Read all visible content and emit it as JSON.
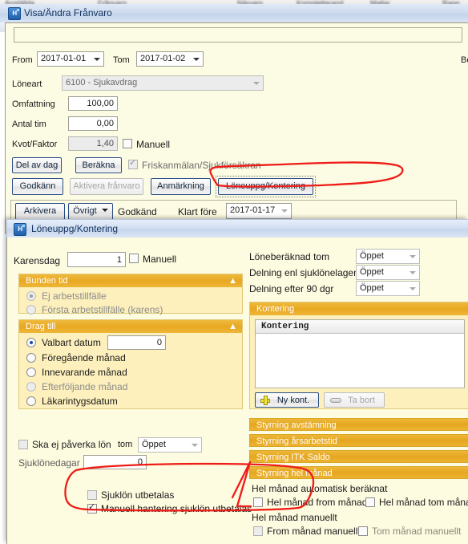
{
  "desktop": {
    "blurred_tabs": [
      "Anställda",
      "Frånvaro",
      "Närvaro",
      "Kompletterand",
      "Mallar",
      "Rapp"
    ]
  },
  "window1": {
    "title": "Visa/Ändra Frånvaro",
    "icon": "hogia-app-icon",
    "fields": {
      "from_label": "From",
      "from_value": "2017-01-01",
      "tom_label": "Tom",
      "tom_value": "2017-01-02",
      "loneart_label": "Löneart",
      "loneart_value": "6100 - Sjukavdrag",
      "omfattning_label": "Omfattning",
      "omfattning_value": "100,00",
      "antal_tim_label": "Antal tim",
      "antal_tim_value": "0,00",
      "kvot_faktor_label": "Kvot/Faktor",
      "kvot_faktor_value": "1,40",
      "manuell_label": "Manuell",
      "manuell_checked": false,
      "cut_off_right_label": "Be"
    },
    "buttons": {
      "del_av_dag": "Del av dag",
      "berakna": "Beräkna",
      "godkann": "Godkänn",
      "aktivera_franvaro": "Aktivera frånvaro",
      "anmarkning": "Anmärkning",
      "loneuppg_kontering": "Löneuppg/Kontering",
      "arkivera": "Arkivera",
      "ovrigt": "Övrigt"
    },
    "friskanmalan_label": "Friskanmälan/Sjukförsäkran",
    "friskanmalan_checked": true,
    "status_label": "Godkänd",
    "klart_fore_label": "Klart före",
    "klart_fore_value": "2017-01-17"
  },
  "window2": {
    "title": "Löneuppg/Kontering",
    "icon": "hogia-app-icon",
    "karensdag_label": "Karensdag",
    "karensdag_value": "1",
    "karensdag_manuell_label": "Manuell",
    "karensdag_manuell_checked": false,
    "bunden_tid": {
      "header": "Bunden tid",
      "options": [
        {
          "label": "Ej arbetstillfälle",
          "selected": true,
          "disabled": true
        },
        {
          "label": "Första arbetstillfälle (karens)",
          "selected": false,
          "disabled": true
        }
      ]
    },
    "drag_till": {
      "header": "Drag till",
      "options": [
        {
          "label": "Valbart datum",
          "selected": true,
          "disabled": false
        },
        {
          "label": "Föregående månad",
          "selected": false,
          "disabled": false
        },
        {
          "label": "Innevarande månad",
          "selected": false,
          "disabled": false
        },
        {
          "label": "Efterföljande månad",
          "selected": false,
          "disabled": true
        },
        {
          "label": "Läkarintygsdatum",
          "selected": false,
          "disabled": false
        }
      ],
      "valbart_datum_value": "0"
    },
    "ska_ej_paverka_lon_label": "Ska ej påverka lön",
    "ska_ej_paverka_lon_checked": false,
    "tom_label": "tom",
    "tom_value": "Öppet",
    "sjuklonedagar_label": "Sjuklönedagar",
    "sjuklonedagar_value": "0",
    "sjuklon_utbetalas_label": "Sjuklön utbetalas",
    "sjuklon_utbetalas_checked": false,
    "manuell_hantering_label": "Manuell hantering sjuklön utbetalas",
    "manuell_hantering_checked": true,
    "right_fields": [
      {
        "label": "Löneberäknad tom",
        "value": "Öppet"
      },
      {
        "label": "Delning enl sjuklönelagen",
        "value": "Öppet"
      },
      {
        "label": "Delning efter 90 dgr",
        "value": "Öppet"
      }
    ],
    "kontering": {
      "header": "Kontering",
      "grid_header": "Kontering",
      "new_button": "Ny kont.",
      "delete_button": "Ta bort"
    },
    "styrning_bars": [
      "Styrning avstämning",
      "Styrning årsarbetstid",
      "Styrning ITK Saldo",
      "Styrning hel månad"
    ],
    "hel_manad": {
      "auto_label": "Hel månad automatisk beräknat",
      "from_auto_label": "Hel månad from månad",
      "from_auto_checked": false,
      "tom_auto_label": "Hel månad tom månad",
      "tom_auto_checked": false,
      "manuellt_label": "Hel månad manuellt",
      "from_manuellt_label": "From månad manuellt",
      "from_manuellt_checked": false,
      "tom_manuellt_label": "Tom månad manuellt",
      "tom_manuellt_checked": false
    }
  },
  "annotations": {
    "color": "#ee1c17",
    "marks": [
      "oval-around-loneuppg-kontering-button",
      "oval-around-sjuklon-checkboxes",
      "arrow-to-hel-manad-from-manad-checkbox"
    ]
  }
}
